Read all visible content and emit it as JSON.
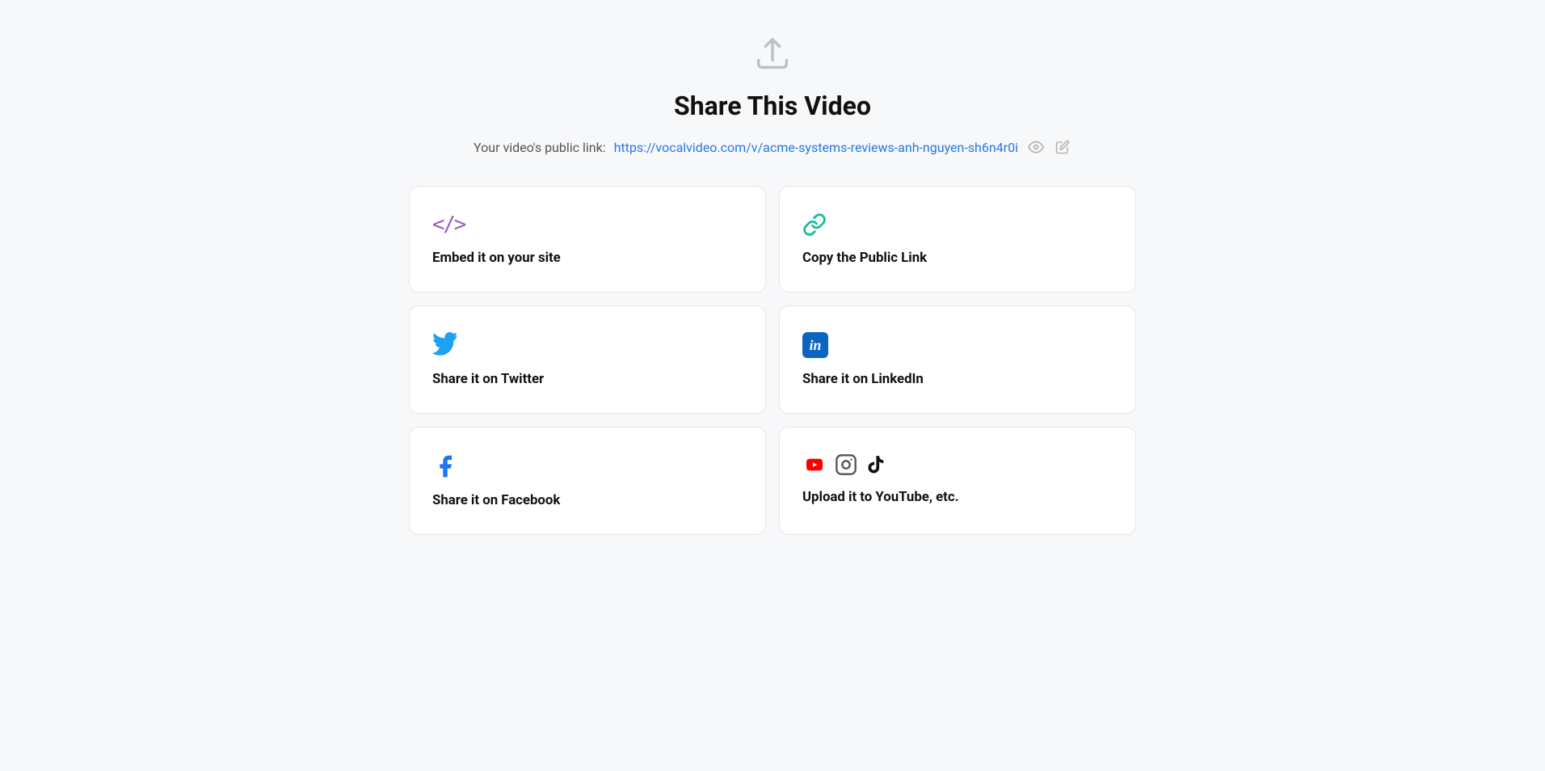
{
  "page": {
    "title": "Share This Video",
    "public_link_label": "Your video's public link:",
    "public_link_url": "https://vocalvideo.com/v/acme-systems-reviews-anh-nguyen-sh6n4r0i"
  },
  "cards": [
    {
      "id": "embed",
      "label": "Embed it on your site",
      "icon_type": "embed"
    },
    {
      "id": "copy-link",
      "label": "Copy the Public Link",
      "icon_type": "link"
    },
    {
      "id": "twitter",
      "label": "Share it on Twitter",
      "icon_type": "twitter"
    },
    {
      "id": "linkedin",
      "label": "Share it on LinkedIn",
      "icon_type": "linkedin"
    },
    {
      "id": "facebook",
      "label": "Share it on Facebook",
      "icon_type": "facebook"
    },
    {
      "id": "youtube",
      "label": "Upload it to YouTube, etc.",
      "icon_type": "youtube-etc"
    }
  ],
  "icons": {
    "upload_label": "⬆",
    "eye_label": "👁",
    "pencil_label": "✏"
  }
}
